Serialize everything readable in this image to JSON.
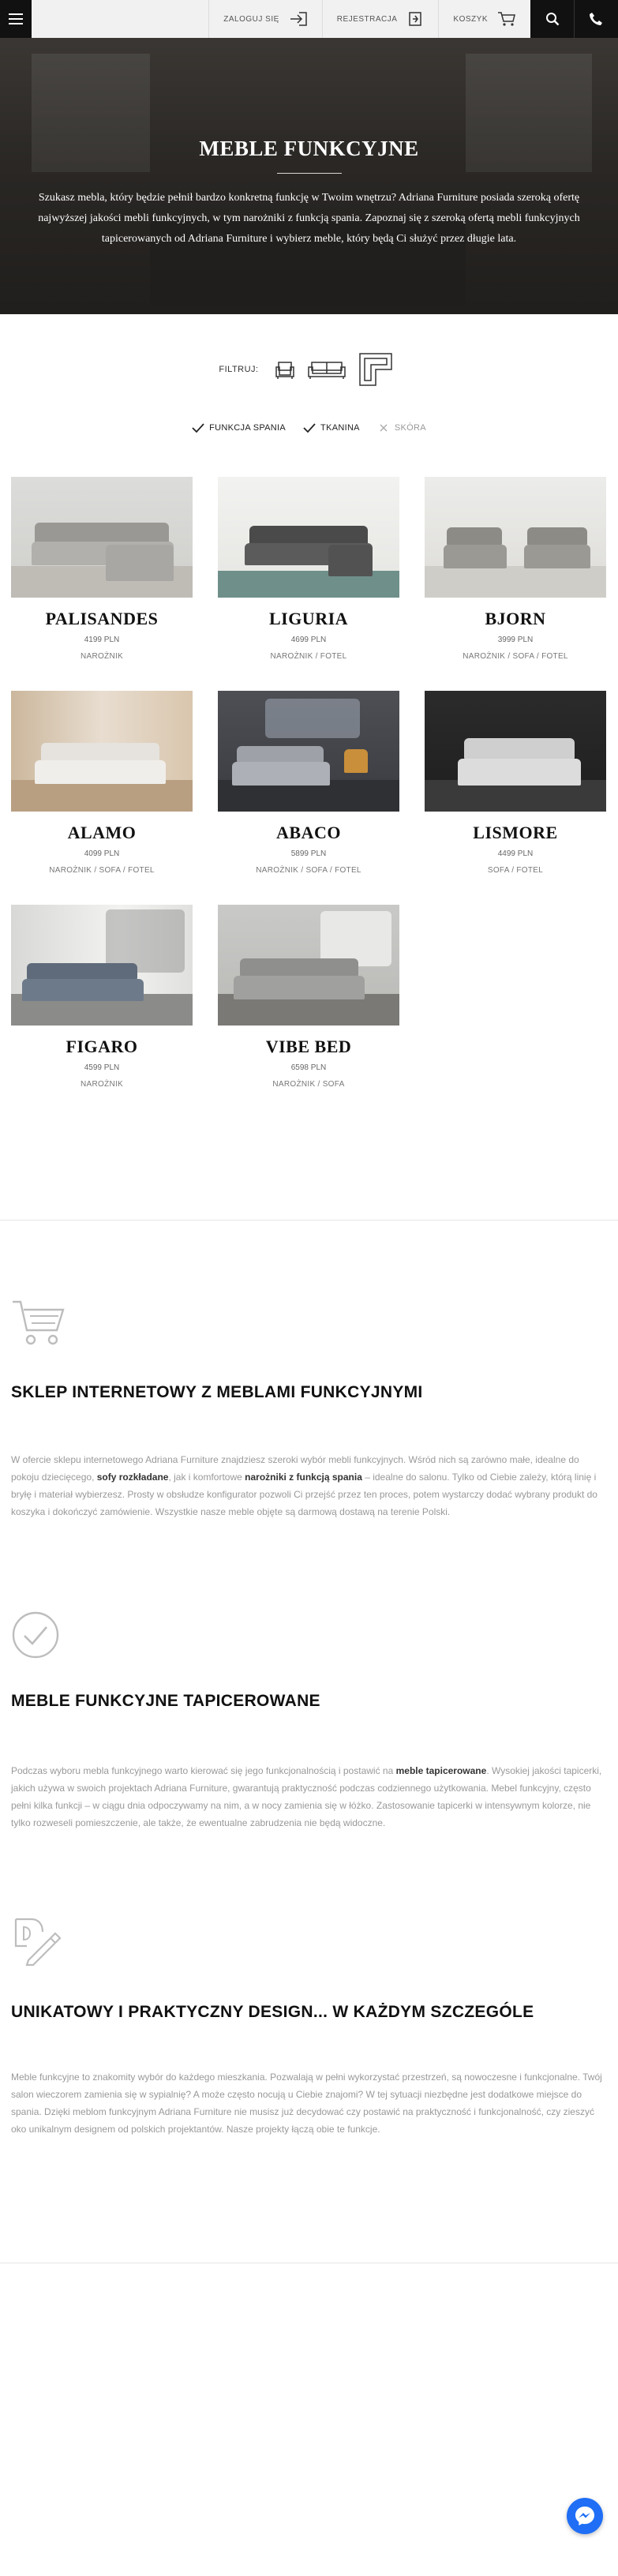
{
  "topbar": {
    "login_label": "ZALOGUJ SIĘ",
    "register_label": "REJESTRACJA",
    "cart_label": "KOSZYK",
    "icons": [
      "menu-icon",
      "login-icon",
      "register-icon",
      "cart-icon",
      "search-icon",
      "phone-icon"
    ]
  },
  "hero": {
    "title": "MEBLE FUNKCYJNE",
    "description": "Szukasz mebla, który będzie pełnił bardzo konkretną funkcję w Twoim wnętrzu? Adriana Furniture posiada szeroką ofertę najwyższej jakości mebli funkcyjnych, w tym narożniki z funkcją spania. Zapoznaj się z szeroką ofertą mebli funkcyjnych tapicerowanych od Adriana Furniture i wybierz meble, który będą Ci służyć przez długie lata."
  },
  "filter": {
    "label": "FILTRUJ:",
    "types": [
      "armchair-icon",
      "sofa-icon",
      "corner-sofa-icon"
    ],
    "checks": [
      {
        "label": "FUNKCJA SPANIA",
        "checked": true
      },
      {
        "label": "TKANINA",
        "checked": true
      },
      {
        "label": "SKÓRA",
        "checked": false
      }
    ]
  },
  "products": [
    {
      "name": "PALISANDES",
      "price": "4199 PLN",
      "category": "NAROŻNIK"
    },
    {
      "name": "LIGURIA",
      "price": "4699 PLN",
      "category": "NAROŻNIK / FOTEL"
    },
    {
      "name": "BJORN",
      "price": "3999 PLN",
      "category": "NAROŻNIK / SOFA / FOTEL"
    },
    {
      "name": "ALAMO",
      "price": "4099 PLN",
      "category": "NAROŻNIK / SOFA / FOTEL"
    },
    {
      "name": "ABACO",
      "price": "5899 PLN",
      "category": "NAROŻNIK / SOFA / FOTEL"
    },
    {
      "name": "LISMORE",
      "price": "4499 PLN",
      "category": "SOFA / FOTEL"
    },
    {
      "name": "FIGARO",
      "price": "4599 PLN",
      "category": "NAROŻNIK"
    },
    {
      "name": "VIBE BED",
      "price": "6598 PLN",
      "category": "NAROŻNIK / SOFA"
    }
  ],
  "sections": [
    {
      "icon": "cart-icon",
      "title": "SKLEP INTERNETOWY Z MEBLAMI FUNKCYJNYMI",
      "text_parts": [
        "W ofercie sklepu internetowego Adriana Furniture znajdziesz szeroki wybór mebli funkcyjnych. Wśród nich są zarówno małe, idealne do pokoju dziecięcego, ",
        "sofy rozkładane",
        ", jak i komfortowe ",
        "narożniki z funkcją spania",
        " – idealne do salonu. Tylko od Ciebie zależy, którą linię i bryłę i materiał wybierzesz. Prosty w obsłudze konfigurator pozwoli Ci przejść przez ten proces, potem wystarczy dodać wybrany produkt do koszyka i dokończyć zamówienie. Wszystkie nasze meble objęte są darmową dostawą na terenie Polski."
      ]
    },
    {
      "icon": "check-circle-icon",
      "title": "MEBLE FUNKCYJNE TAPICEROWANE",
      "text_parts": [
        "Podczas wyboru mebla funkcyjnego warto kierować się jego funkcjonalnością i postawić na ",
        "meble tapicerowane",
        ". Wysokiej jakości tapicerki, jakich używa w swoich projektach Adriana Furniture, gwarantują praktyczność podczas codziennego użytkowania. Mebel funkcyjny, często pełni kilka funkcji – w ciągu dnia odpoczywamy na nim, a w nocy zamienia się w łóżko. Zastosowanie tapicerki w intensywnym kolorze, nie tylko rozweseli pomieszczenie, ale także, że ewentualne zabrudzenia nie będą widoczne."
      ]
    },
    {
      "icon": "design-pencil-icon",
      "title": "UNIKATOWY I PRAKTYCZNY DESIGN... W KAŻDYM SZCZEGÓLE",
      "text_parts": [
        "Meble funkcyjne to znakomity wybór do każdego mieszkania. Pozwalają w pełni wykorzystać przestrzeń, są nowoczesne i funkcjonalne. Twój salon wieczorem zamienia się w sypialnię? A może często nocują u Ciebie znajomi? W tej sytuacji niezbędne jest dodatkowe miejsce do spania. Dzięki meblom funkcyjnym Adriana Furniture nie musisz już decydować czy postawić na praktyczność i funkcjonalność, czy zieszyć oko unikalnym designem od polskich projektantów. Nasze projekty łączą obie te funkcje."
      ]
    }
  ],
  "floating": {
    "icon": "messenger-icon"
  },
  "colors": {
    "topbar_dark": "#111111",
    "topbar_light": "#f1f1f1",
    "messenger": "#1f6ef5"
  }
}
